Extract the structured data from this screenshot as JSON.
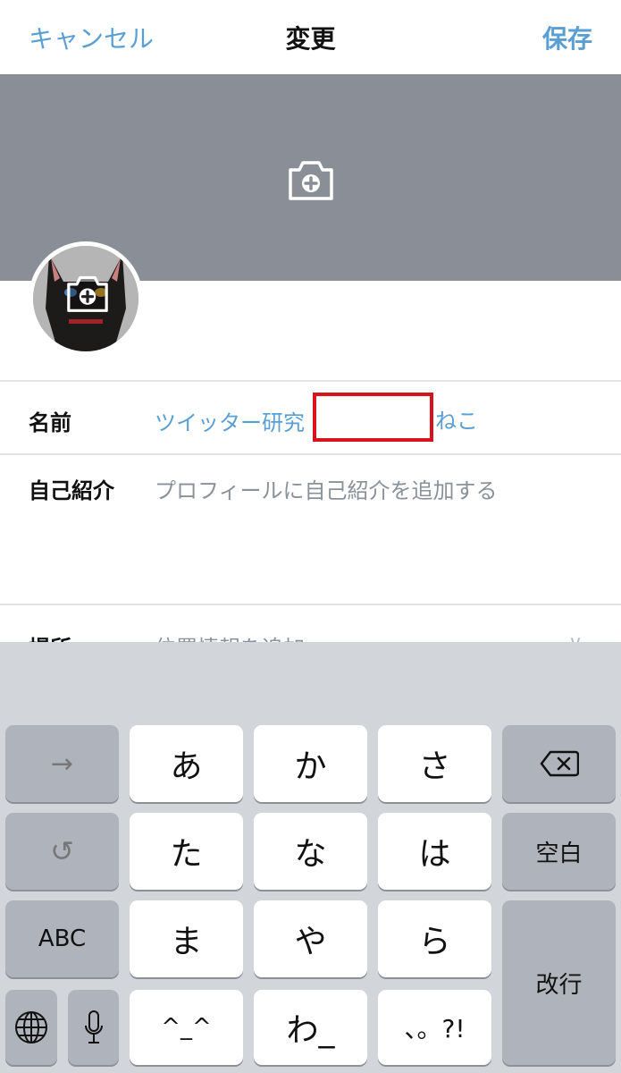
{
  "nav": {
    "cancel_label": "キャンセル",
    "title": "変更",
    "save_label": "保存"
  },
  "colors": {
    "accent": "#5a9fd4",
    "banner": "#8a8f97",
    "redaction": "#d7141b",
    "keyboard_bg": "#d2d5da",
    "key_dark": "#afb3bb"
  },
  "banner": {
    "icon": "camera-add-icon"
  },
  "avatar": {
    "icon": "camera-add-icon",
    "image": "black-cat-avatar"
  },
  "fields": {
    "name": {
      "label": "名前",
      "value_prefix": "ツイッター研究",
      "value_suffix": "ねこ"
    },
    "bio": {
      "label": "自己紹介",
      "placeholder": "プロフィールに自己紹介を追加する"
    },
    "location": {
      "label": "場所",
      "placeholder": "位置情報を追加",
      "icon": "chevron-down-icon"
    }
  },
  "keyboard": {
    "keys": {
      "next": "→",
      "a": "あ",
      "ka": "か",
      "sa": "さ",
      "backspace": "⌫",
      "undo": "↺",
      "ta": "た",
      "na": "な",
      "ha": "は",
      "space": "空白",
      "abc": "ABC",
      "ma": "ま",
      "ya": "や",
      "ra": "ら",
      "return": "改行",
      "globe": "🌐",
      "mic": "🎤",
      "kaomoji": "^_^",
      "wa": "わ_",
      "punct": "、。?!"
    }
  }
}
